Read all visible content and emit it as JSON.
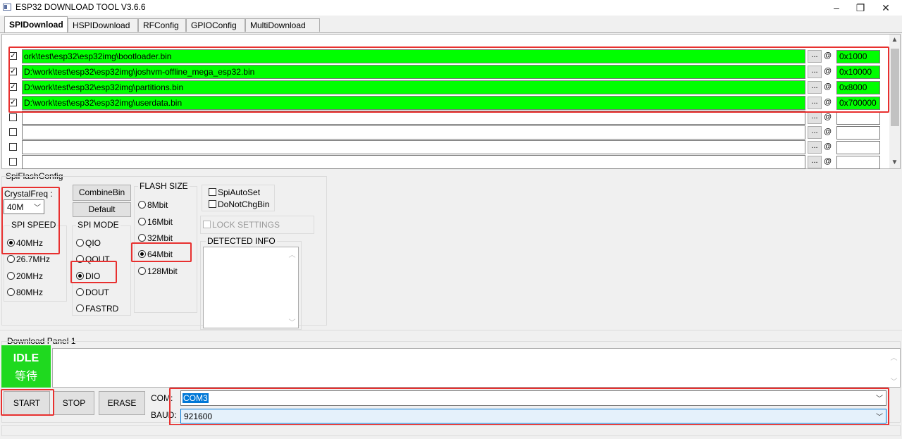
{
  "window": {
    "title": "ESP32 DOWNLOAD TOOL V3.6.6",
    "minimize": "–",
    "restore": "❐",
    "close": "✕"
  },
  "tabs": [
    "SPIDownload",
    "HSPIDownload",
    "RFConfig",
    "GPIOConfig",
    "MultiDownload"
  ],
  "files": [
    {
      "checked": true,
      "path": "ork\\test\\esp32\\esp32img\\bootloader.bin",
      "dots": "...",
      "at": "@",
      "address": "0x1000"
    },
    {
      "checked": true,
      "path": "D:\\work\\test\\esp32\\esp32img\\joshvm-offline_mega_esp32.bin",
      "dots": "...",
      "at": "@",
      "address": "0x10000"
    },
    {
      "checked": true,
      "path": "D:\\work\\test\\esp32\\esp32img\\partitions.bin",
      "dots": "...",
      "at": "@",
      "address": "0x8000"
    },
    {
      "checked": true,
      "path": "D:\\work\\test\\esp32\\esp32img\\userdata.bin",
      "dots": "...",
      "at": "@",
      "address": "0x700000"
    },
    {
      "checked": false,
      "path": "",
      "dots": "...",
      "at": "@",
      "address": ""
    },
    {
      "checked": false,
      "path": "",
      "dots": "...",
      "at": "@",
      "address": ""
    },
    {
      "checked": false,
      "path": "",
      "dots": "...",
      "at": "@",
      "address": ""
    },
    {
      "checked": false,
      "path": "",
      "dots": "...",
      "at": "@",
      "address": ""
    }
  ],
  "spi": {
    "section_label": "SpiFlashConfig",
    "crystal_label": "CrystalFreq :",
    "crystal_value": "40M",
    "combine_bin": "CombineBin",
    "default": "Default",
    "flash_size_label": "FLASH SIZE",
    "flash_sizes": [
      "8Mbit",
      "16Mbit",
      "32Mbit",
      "64Mbit",
      "128Mbit"
    ],
    "flash_size_selected": "64Mbit",
    "spi_speed_label": "SPI SPEED",
    "spi_speeds": [
      "40MHz",
      "26.7MHz",
      "20MHz",
      "80MHz"
    ],
    "spi_speed_selected": "40MHz",
    "spi_mode_label": "SPI MODE",
    "spi_modes": [
      "QIO",
      "QOUT",
      "DIO",
      "DOUT",
      "FASTRD"
    ],
    "spi_mode_selected": "DIO",
    "spi_auto_set": "SpiAutoSet",
    "do_not_chg_bin": "DoNotChgBin",
    "lock_settings": "LOCK SETTINGS",
    "detected_info": "DETECTED INFO"
  },
  "download": {
    "panel_label": "Download Panel 1",
    "status_en": "IDLE",
    "status_cn": "等待",
    "status_color": "#1fd91f",
    "start": "START",
    "stop": "STOP",
    "erase": "ERASE",
    "com_label": "COM:",
    "com_value": "COM3",
    "baud_label": "BAUD:",
    "baud_value": "921600"
  }
}
